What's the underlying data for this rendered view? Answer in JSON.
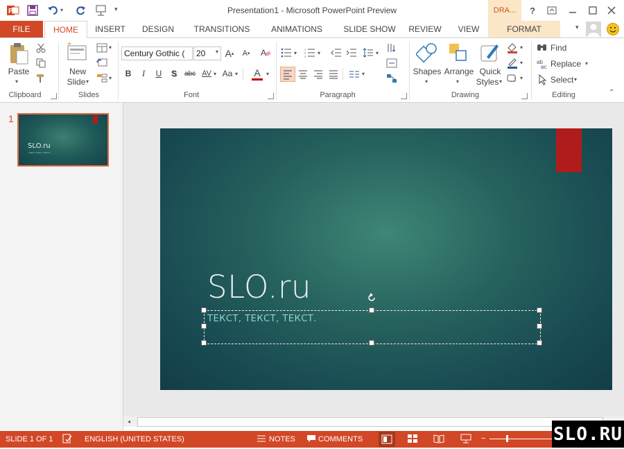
{
  "title_bar": {
    "app_title": "Presentation1 - Microsoft PowerPoint Preview",
    "contextual_tab_group": "DRA...",
    "help": "?"
  },
  "tabs": {
    "file": "FILE",
    "items": [
      "HOME",
      "INSERT",
      "DESIGN",
      "TRANSITIONS",
      "ANIMATIONS",
      "SLIDE SHOW",
      "REVIEW",
      "VIEW",
      "FORMAT"
    ],
    "active": "HOME"
  },
  "ribbon": {
    "clipboard": {
      "paste": "Paste",
      "group": "Clipboard"
    },
    "slides": {
      "new_slide_line1": "New",
      "new_slide_line2": "Slide",
      "group": "Slides"
    },
    "font": {
      "font_name": "Century Gothic (",
      "font_size": "20",
      "bold": "B",
      "italic": "I",
      "underline": "U",
      "shadow": "S",
      "strike": "abc",
      "spacing": "AV",
      "case": "Aa",
      "color": "A",
      "grow": "A",
      "shrink": "A",
      "group": "Font"
    },
    "paragraph": {
      "group": "Paragraph"
    },
    "drawing": {
      "shapes": "Shapes",
      "arrange": "Arrange",
      "quick_line1": "Quick",
      "quick_line2": "Styles",
      "group": "Drawing"
    },
    "editing": {
      "find": "Find",
      "replace": "Replace",
      "select": "Select",
      "group": "Editing"
    }
  },
  "thumbnails": [
    {
      "number": "1",
      "title": "SLO.ru",
      "subtitle": "ТЕКСТ, ТЕКСТ, ТЕКСТ."
    }
  ],
  "slide": {
    "title": "SLO.ru",
    "subtitle": "ТЕКСТ, ТЕКСТ, ТЕКСТ."
  },
  "status_bar": {
    "slide_count": "SLIDE 1 OF 1",
    "language": "ENGLISH (UNITED STATES)",
    "notes": "NOTES",
    "comments": "COMMENTS"
  },
  "watermark": {
    "text": "SLO.RU"
  },
  "colors": {
    "accent": "#d24726",
    "contextual": "#fbe6c8",
    "slide_bg": "#26625d",
    "slide_ribbon": "#b01c1c",
    "subtitle_text": "#8ed6c8"
  }
}
